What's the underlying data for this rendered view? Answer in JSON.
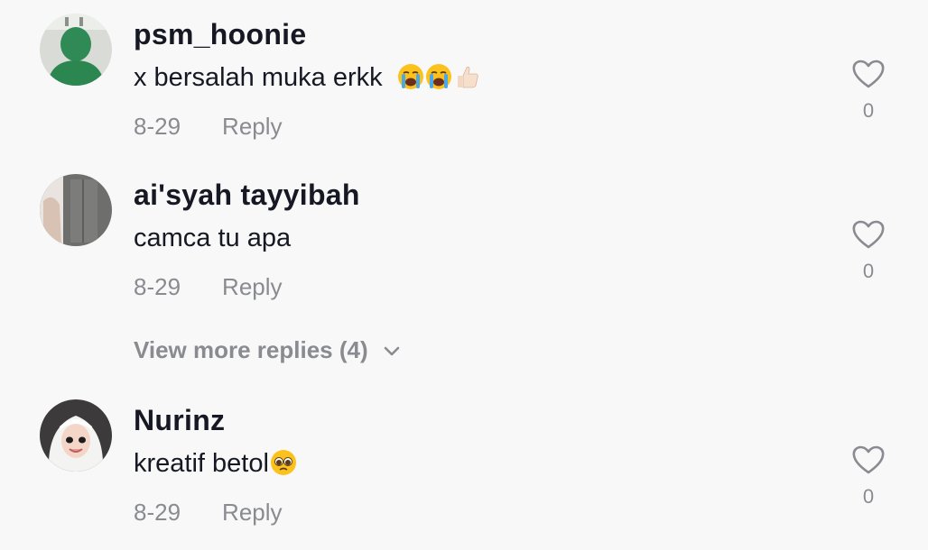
{
  "comments": [
    {
      "username": "psm_hoonie",
      "text": "x bersalah muka erkk",
      "emojis": [
        "loudly-crying-face",
        "loudly-crying-face",
        "thumbs-up"
      ],
      "date": "8-29",
      "reply_label": "Reply",
      "likes": "0"
    },
    {
      "username": "ai'syah tayyibah",
      "text": "camca tu apa",
      "emojis": [],
      "date": "8-29",
      "reply_label": "Reply",
      "likes": "0",
      "view_more": "View more replies (4)"
    },
    {
      "username": "Nurinz",
      "text": "kreatif betol",
      "emojis": [
        "pleading-face"
      ],
      "date": "8-29",
      "reply_label": "Reply",
      "likes": "0"
    }
  ],
  "colors": {
    "background": "#f8f8f8",
    "primary_text": "#161823",
    "secondary_text": "#8a8b91"
  }
}
